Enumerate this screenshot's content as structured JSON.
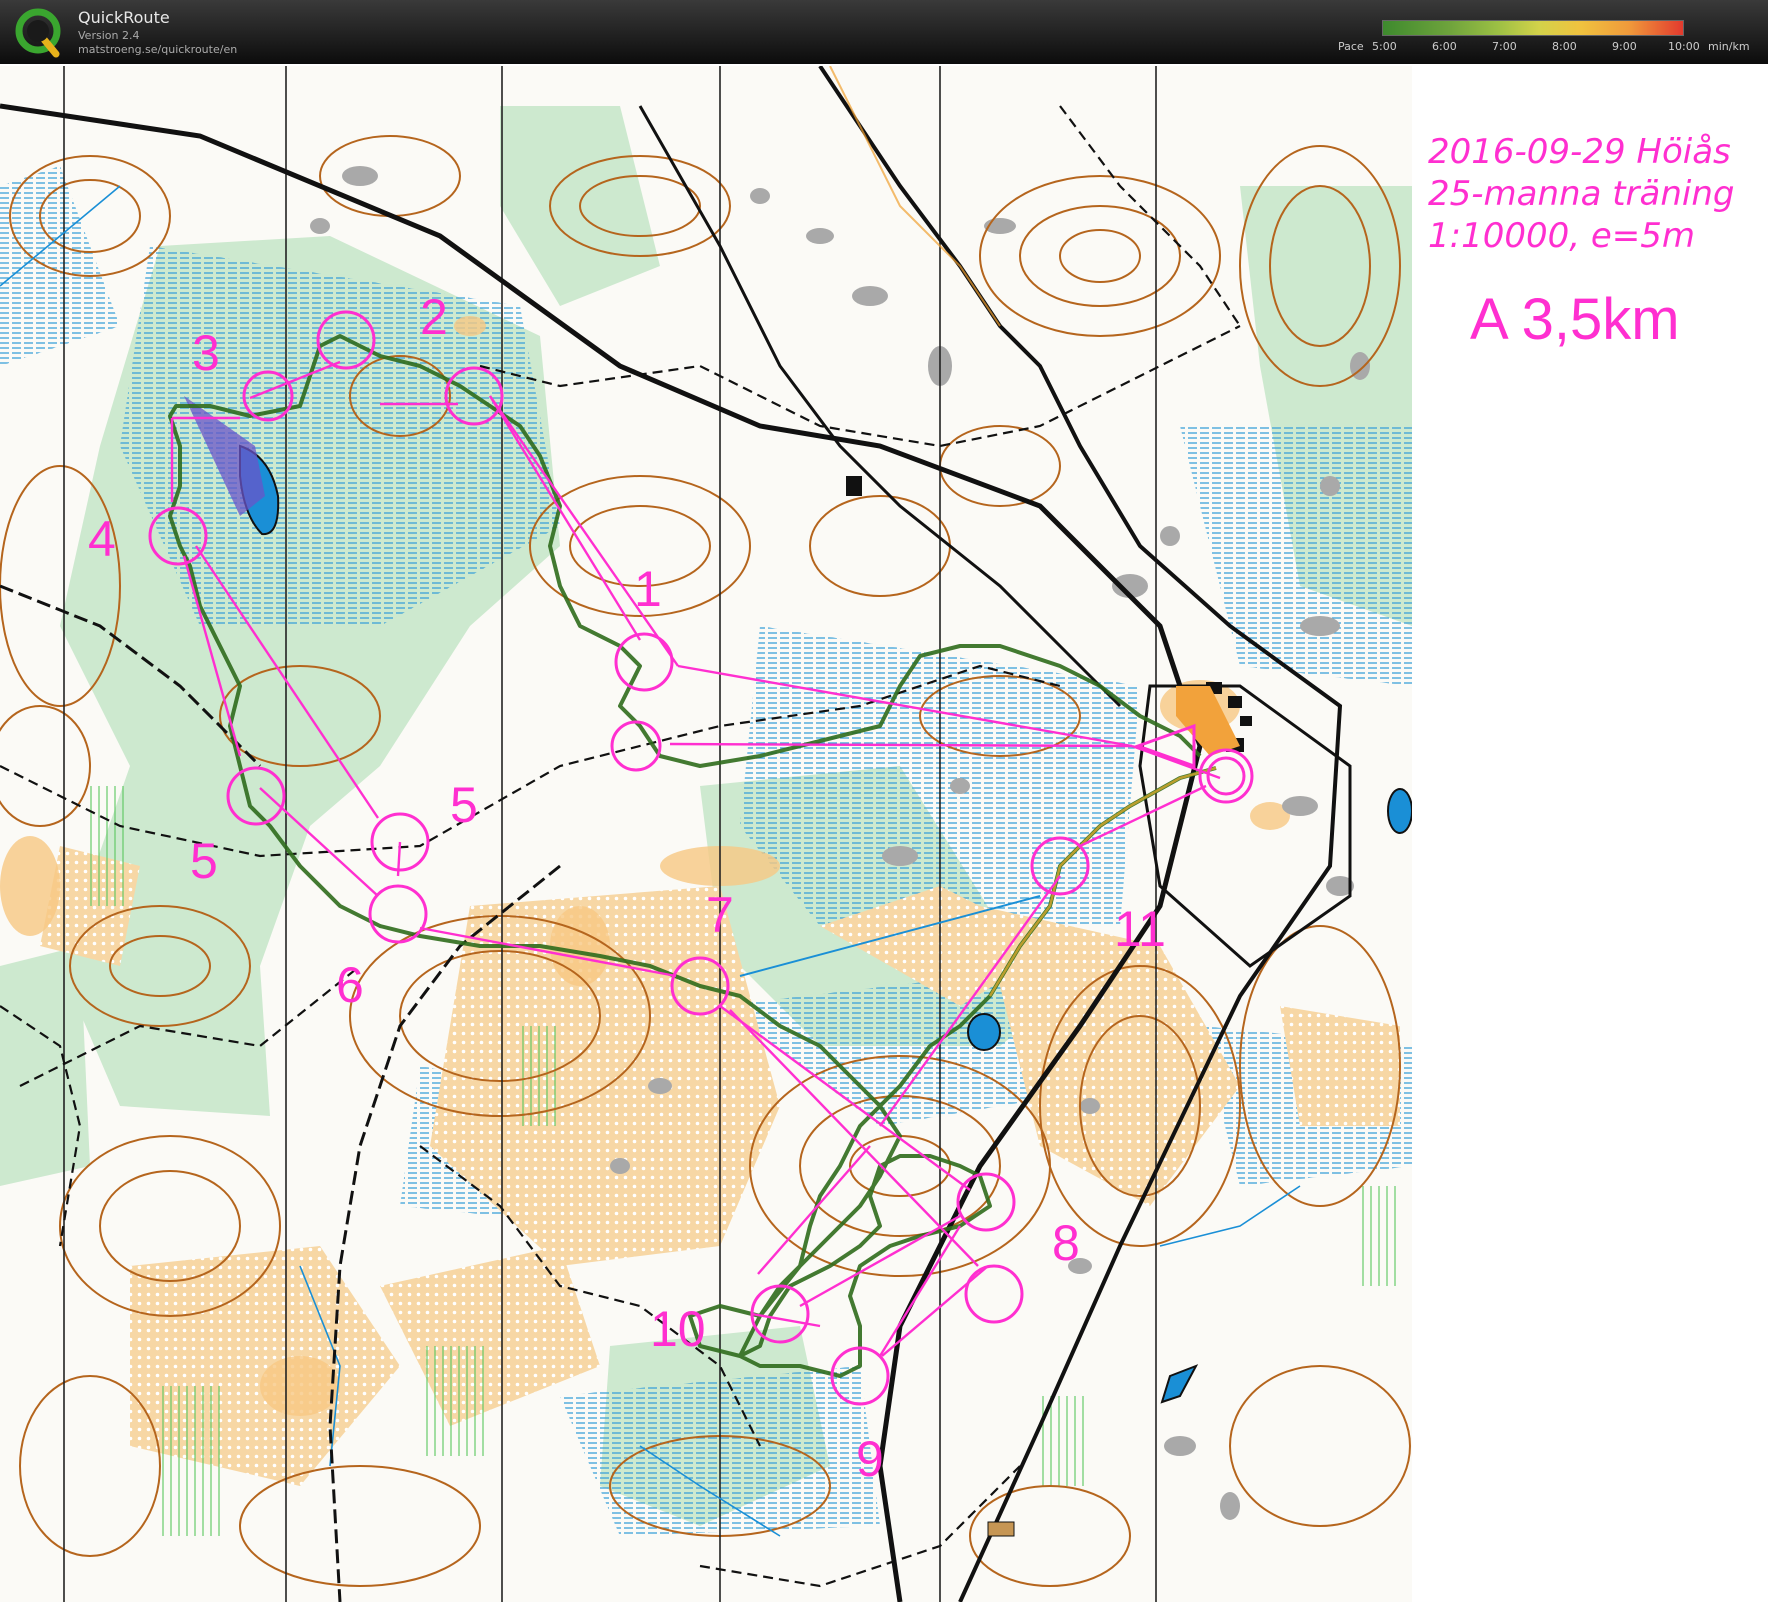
{
  "header": {
    "app_title": "QuickRoute",
    "version": "Version 2.4",
    "url": "matstroeng.se/quickroute/en",
    "pace_label": "Pace",
    "pace_ticks": [
      "5:00",
      "6:00",
      "7:00",
      "8:00",
      "9:00",
      "10:00"
    ],
    "pace_unit": "min/km"
  },
  "info": {
    "line1": "2016-09-29 Höiås",
    "line2": "25-manna träning",
    "line3": "1:10000, e=5m",
    "course": "A 3,5km"
  },
  "controls": [
    "1",
    "2",
    "3",
    "4",
    "5",
    "5",
    "6",
    "7",
    "8",
    "9",
    "10",
    "11"
  ],
  "colors": {
    "course": "#ff2fd0",
    "route": "#3f7a2a",
    "water": "#1a8fd6",
    "open_land": "#f7c883",
    "green": "#9fd7a6",
    "contour": "#b5651d"
  }
}
